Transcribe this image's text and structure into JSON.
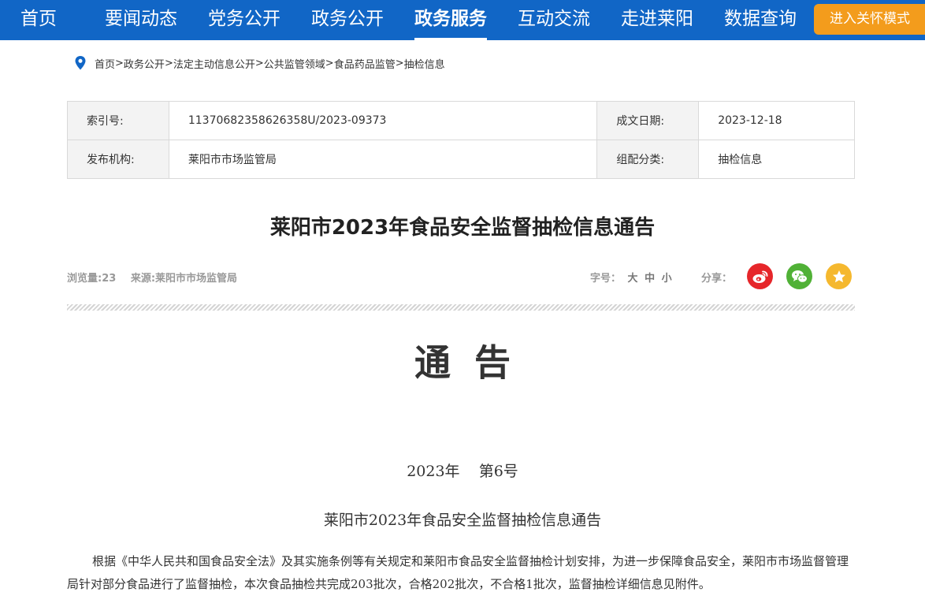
{
  "nav": {
    "items": [
      {
        "label": "首页"
      },
      {
        "label": "要闻动态"
      },
      {
        "label": "党务公开"
      },
      {
        "label": "政务公开"
      },
      {
        "label": "政务服务"
      },
      {
        "label": "互动交流"
      },
      {
        "label": "走进莱阳"
      },
      {
        "label": "数据查询"
      }
    ],
    "active_index": 4,
    "care_mode_label": "进入关怀模式"
  },
  "breadcrumb": {
    "items": [
      "首页",
      "政务公开",
      "法定主动信息公开",
      "公共监管领域",
      "食品药品监管",
      "抽检信息"
    ],
    "separator": ">"
  },
  "meta": {
    "index_label": "索引号:",
    "index_value": "11370682358626358U/2023-09373",
    "date_label": "成文日期:",
    "date_value": "2023-12-18",
    "publisher_label": "发布机构:",
    "publisher_value": "莱阳市市场监管局",
    "category_label": "组配分类:",
    "category_value": "抽检信息"
  },
  "article": {
    "title": "莱阳市2023年食品安全监督抽检信息通告",
    "views": "浏览量:23",
    "source": "来源:莱阳市市场监管局",
    "font_size_label": "字号：",
    "font_size_options": [
      "大",
      "中",
      "小"
    ],
    "share_label": "分享：",
    "notice_heading": "通告",
    "doc_number": "2023年    第6号",
    "sub_title": "莱阳市2023年食品安全监督抽检信息通告",
    "paragraph": "根据《中华人民共和国食品安全法》及其实施条例等有关规定和莱阳市食品安全监督抽检计划安排，为进一步保障食品安全，莱阳市市场监督管理局针对部分食品进行了监督抽检，本次食品抽检共完成203批次，合格202批次，不合格1批次，监督抽检详细信息见附件。"
  },
  "colors": {
    "nav_bg": "#1166c6",
    "care_btn": "#f39c1c",
    "weibo": "#e6262a",
    "wechat": "#50b136",
    "favorite": "#f5b82e"
  }
}
